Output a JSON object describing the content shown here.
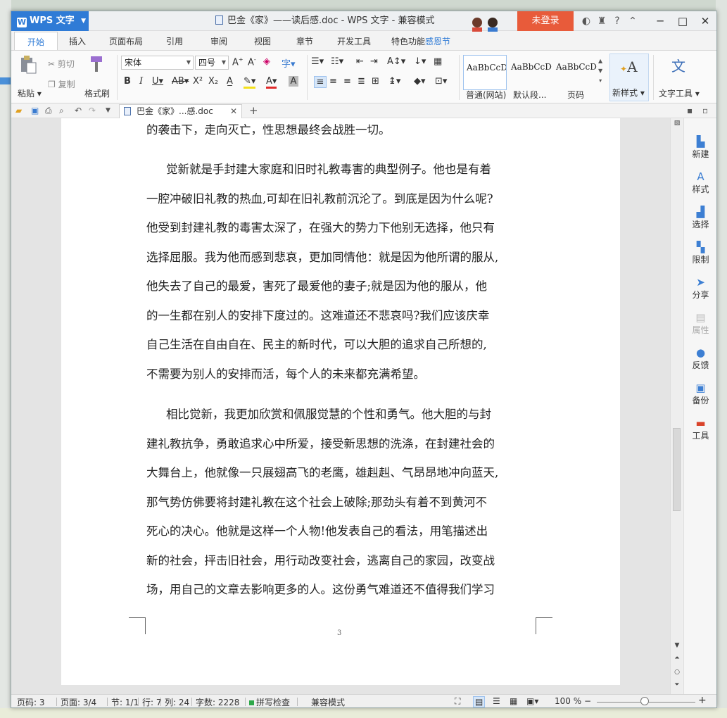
{
  "app": {
    "brand": "WPS 文字",
    "window_title": "巴金《家》——读后感.doc - WPS 文字 - 兼容模式",
    "login_label": "未登录"
  },
  "tabs": [
    {
      "label": "开始"
    },
    {
      "label": "插入"
    },
    {
      "label": "页面布局"
    },
    {
      "label": "引用"
    },
    {
      "label": "审阅"
    },
    {
      "label": "视图"
    },
    {
      "label": "章节"
    },
    {
      "label": "开发工具"
    }
  ],
  "special_tab": {
    "label": "特色功能",
    "highlight": "感恩节"
  },
  "ribbon": {
    "paste": "粘贴",
    "cut": "剪切",
    "copy": "复制",
    "format_painter": "格式刷",
    "font_name": "宋体",
    "font_size": "四号",
    "styles": [
      {
        "preview": "AaBbCcDd",
        "name": "普通(网站)"
      },
      {
        "preview": "AaBbCcDd",
        "name": "默认段..."
      },
      {
        "preview": "AaBbCcDd",
        "name": "页码"
      }
    ],
    "new_style": "新样式",
    "text_tools": "文字工具"
  },
  "doc_tab": {
    "label": "巴金《家》...感.doc"
  },
  "document": {
    "lines_top": [
      "的袭击下，走向灭亡，性思想最终会战胜一切。"
    ],
    "para1": [
      "觉新就是手封建大家庭和旧时礼教毒害的典型例子。他也是有着",
      "一腔冲破旧礼教的热血,可却在旧礼教前沉沦了。到底是因为什么呢?",
      "他受到封建礼教的毒害太深了，在强大的势力下他别无选择，他只有",
      "选择屈服。我为他而感到悲哀，更加同情他：就是因为他所谓的服从,",
      "他失去了自己的最爱，害死了最爱他的妻子;就是因为他的服从，他",
      "的一生都在别人的安排下度过的。这难道还不悲哀吗?我们应该庆幸",
      "自己生活在自由自在、民主的新时代，可以大胆的追求自己所想的,",
      "不需要为别人的安排而活，每个人的未来都充满希望。"
    ],
    "para2": [
      "相比觉新，我更加欣赏和佩服觉慧的个性和勇气。他大胆的与封",
      "建礼教抗争，勇敢追求心中所爱，接受新思想的洗涤，在封建社会的",
      "大舞台上，他就像一只展翅高飞的老鹰，雄赳赳、气昂昂地冲向蓝天,",
      "那气势仿佛要将封建礼教在这个社会上破除;那劲头有着不到黄河不",
      "死心的决心。他就是这样一个人物!他发表自己的看法，用笔描述出",
      "新的社会，抨击旧社会，用行动改变社会，逃离自己的家园，改变战",
      "场，用自己的文章去影响更多的人。这份勇气难道还不值得我们学习"
    ],
    "page_number": "3"
  },
  "right_panel": [
    {
      "label": "新建",
      "icon": "new-doc-icon",
      "glyph": "▙",
      "enabled": true
    },
    {
      "label": "样式",
      "icon": "style-icon",
      "glyph": "A",
      "enabled": true
    },
    {
      "label": "选择",
      "icon": "select-icon",
      "glyph": "▟",
      "enabled": true
    },
    {
      "label": "限制",
      "icon": "restrict-icon",
      "glyph": "▚",
      "enabled": true
    },
    {
      "label": "分享",
      "icon": "share-icon",
      "glyph": "➤",
      "enabled": true
    },
    {
      "label": "属性",
      "icon": "properties-icon",
      "glyph": "▤",
      "enabled": false
    },
    {
      "label": "反馈",
      "icon": "feedback-icon",
      "glyph": "●",
      "enabled": true
    },
    {
      "label": "备份",
      "icon": "backup-icon",
      "glyph": "▣",
      "enabled": true
    },
    {
      "label": "工具",
      "icon": "toolbox-icon",
      "glyph": "▬",
      "enabled": true
    }
  ],
  "status": {
    "page_code": "页码: 3",
    "pages": "页面: 3/4",
    "section": "节: 1/1",
    "row": "行: 7",
    "col": "列: 24",
    "words": "字数: 2228",
    "spell": "拼写检查",
    "mode": "兼容模式",
    "zoom": "100 %"
  },
  "colors": {
    "accent": "#2f7bd6",
    "login": "#e85b3a"
  }
}
